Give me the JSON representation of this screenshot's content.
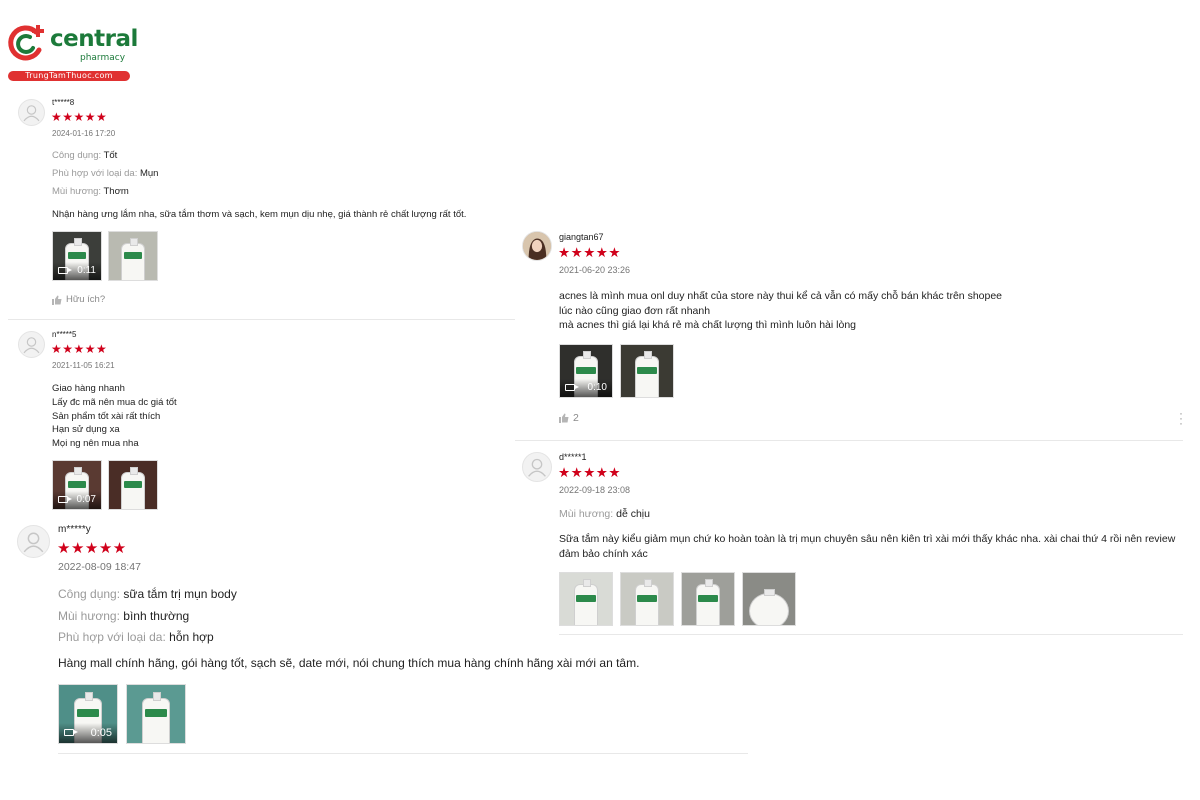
{
  "brand": {
    "name": "central",
    "sub": "pharmacy",
    "site": "TrungTamThuoc.com",
    "green": "#1c7a3a",
    "red": "#e03131"
  },
  "star_color": "#d0011b",
  "reviews": [
    {
      "username": "t*****8",
      "rating": 5,
      "stars": "★★★★★",
      "date": "2024-01-16 17:20",
      "attrs": [
        {
          "k": "Công dụng:",
          "v": "Tốt"
        },
        {
          "k": "Phù hợp với loại da:",
          "v": "Mụn"
        },
        {
          "k": "Mùi hương:",
          "v": "Thơm"
        }
      ],
      "text": [
        "Nhận hàng ưng lắm nha, sữa tắm thơm và sạch, kem mụn dịu nhẹ, giá thành rẻ chất lượng rất tốt."
      ],
      "video_duration": "0:11",
      "helpful": "Hữu ích?"
    },
    {
      "username": "n*****5",
      "rating": 5,
      "stars": "★★★★★",
      "date": "2021-11-05 16:21",
      "text": [
        "Giao hàng nhanh",
        "Lấy đc mã nên mua dc giá tốt",
        "Sản phẩm tốt xài rất thích",
        "Hạn sử dụng xa",
        "Mọi ng nên mua nha"
      ],
      "video_duration": "0:07"
    },
    {
      "username": "m*****y",
      "rating": 5,
      "stars": "★★★★★",
      "date": "2022-08-09 18:47",
      "attrs": [
        {
          "k": "Công dụng:",
          "v": "sữa tắm trị mụn body"
        },
        {
          "k": "Mùi hương:",
          "v": "bình thường"
        },
        {
          "k": "Phù hợp với loại da:",
          "v": "hỗn hợp"
        }
      ],
      "text": [
        "Hàng mall chính hãng, gói hàng tốt, sạch sẽ, date mới, nói chung thích mua hàng chính hãng xài mới an tâm."
      ],
      "video_duration": "0:05"
    },
    {
      "username": "giangtan67",
      "rating": 5,
      "stars": "★★★★★",
      "date": "2021-06-20 23:26",
      "text": [
        "acnes là mình mua onl duy nhất của store này thui kể cả vẫn có mấy chỗ bán khác trên shopee",
        "lúc nào cũng giao đơn rất nhanh",
        "mà acnes thì giá lại khá rẻ mà chất lượng thì mình luôn hài lòng"
      ],
      "video_duration": "0:10",
      "helpful_count": "2"
    },
    {
      "username": "d*****1",
      "rating": 5,
      "stars": "★★★★★",
      "date": "2022-09-18 23:08",
      "attrs": [
        {
          "k": "Mùi hương:",
          "v": "dễ chịu"
        }
      ],
      "text": [
        "Sữa tắm này kiểu giảm mụn chứ ko hoàn toàn là trị mụn chuyên sâu nên kiên trì xài mới thấy khác nha. xài chai thứ 4 rồi nên review",
        "đảm bảo chính xác"
      ]
    }
  ]
}
